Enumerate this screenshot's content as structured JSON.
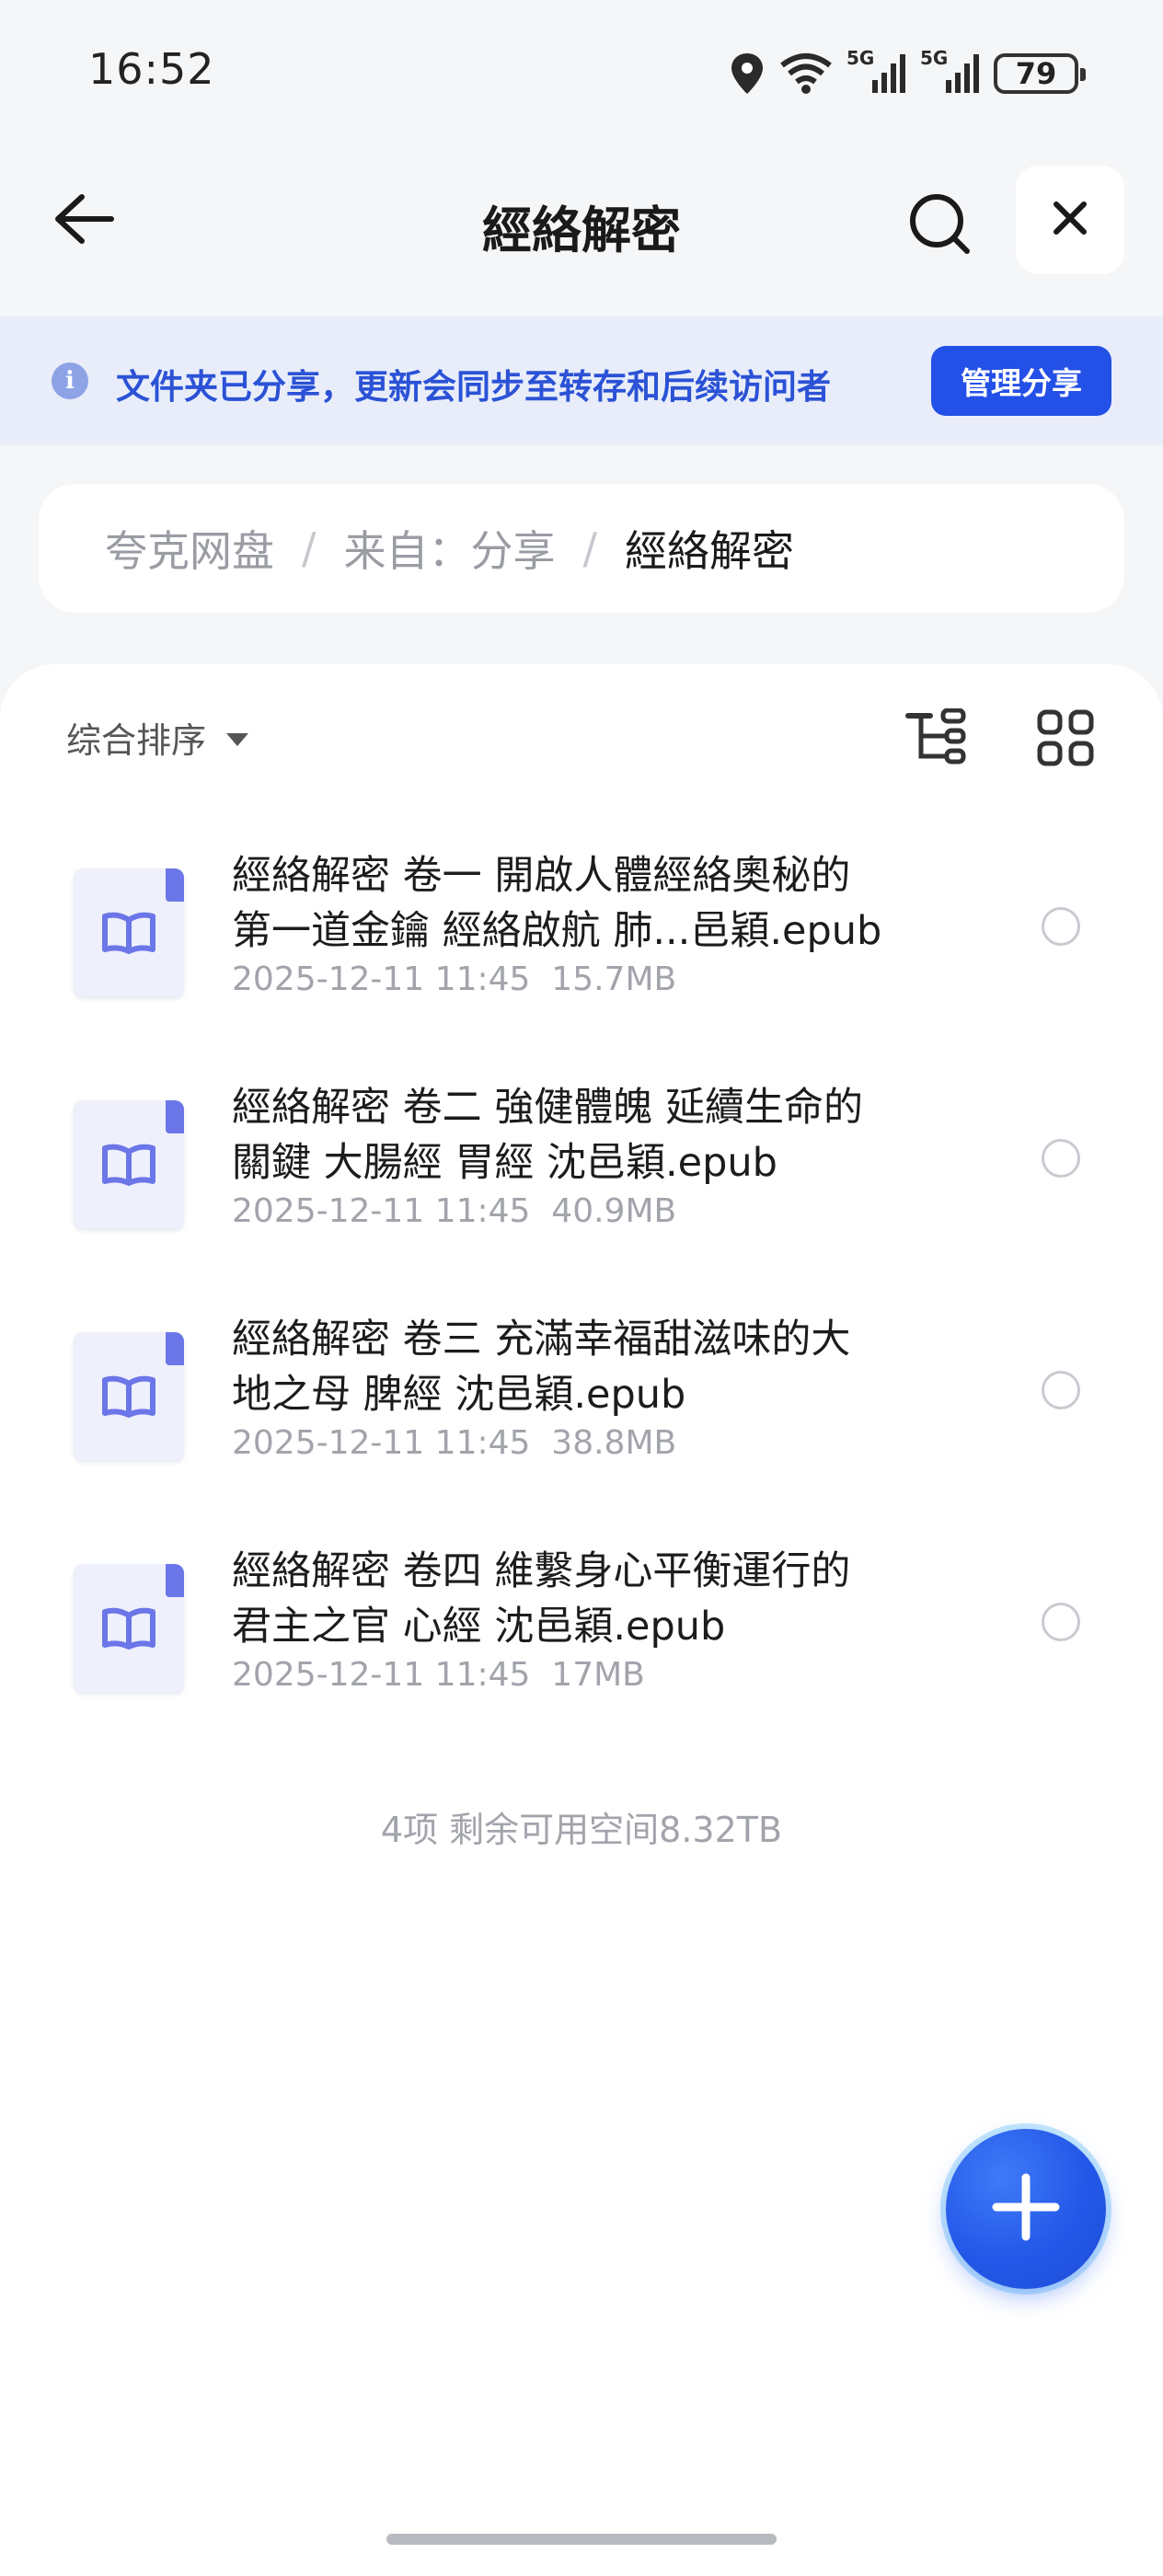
{
  "status_bar": {
    "time": "16:52",
    "network_1": "5G",
    "network_2": "5G",
    "battery": "79",
    "icons": [
      "location-icon",
      "wifi-icon",
      "signal-icon",
      "signal-icon",
      "battery-icon"
    ]
  },
  "header": {
    "title": "經絡解密",
    "back_icon": "arrow-left-icon",
    "search_icon": "search-icon",
    "close_icon": "close-icon"
  },
  "share_banner": {
    "icon": "info-icon",
    "icon_glyph": "i",
    "text": "文件夹已分享，更新会同步至转存和后续访问者",
    "button_label": "管理分享"
  },
  "breadcrumb": {
    "items": [
      "夸克网盘",
      "来自：分享",
      "經絡解密"
    ],
    "separator": "/"
  },
  "toolbar": {
    "sort_label": "综合排序",
    "tree_icon": "tree-view-icon",
    "grid_icon": "grid-view-icon"
  },
  "files": [
    {
      "name": "經絡解密 卷一 開啟人體經絡奧秘的第一道金鑰 經絡啟航 肺...邑穎.epub",
      "line1": "經絡解密 卷一 開啟人體經絡奧秘的",
      "line2": "第一道金鑰 經絡啟航 肺...邑穎.epub",
      "date": "2025-12-11 11:45",
      "size": "15.7MB",
      "icon": "epub-book-icon"
    },
    {
      "name": "經絡解密 卷二 強健體魄 延續生命的關鍵 大腸經 胃經 沈邑穎.epub",
      "line1": "經絡解密 卷二 強健體魄 延續生命的",
      "line2": "關鍵 大腸經 胃經 沈邑穎.epub",
      "date": "2025-12-11 11:45",
      "size": "40.9MB",
      "icon": "epub-book-icon"
    },
    {
      "name": "經絡解密 卷三 充滿幸福甜滋味的大地之母 脾經 沈邑穎.epub",
      "line1": "經絡解密 卷三 充滿幸福甜滋味的大",
      "line2": "地之母 脾經 沈邑穎.epub",
      "date": "2025-12-11 11:45",
      "size": "38.8MB",
      "icon": "epub-book-icon"
    },
    {
      "name": "經絡解密 卷四 維繫身心平衡運行的君主之官 心經 沈邑穎.epub",
      "line1": "經絡解密 卷四 維繫身心平衡運行的",
      "line2": "君主之官 心經 沈邑穎.epub",
      "date": "2025-12-11 11:45",
      "size": "17MB",
      "icon": "epub-book-icon"
    }
  ],
  "summary": "4项 剩余可用空间8.32TB",
  "fab": {
    "icon": "plus-icon"
  },
  "colors": {
    "accent": "#2350e6",
    "banner_bg": "#e8edf9",
    "banner_text": "#2b52d6",
    "file_icon": "#6b76e8"
  }
}
